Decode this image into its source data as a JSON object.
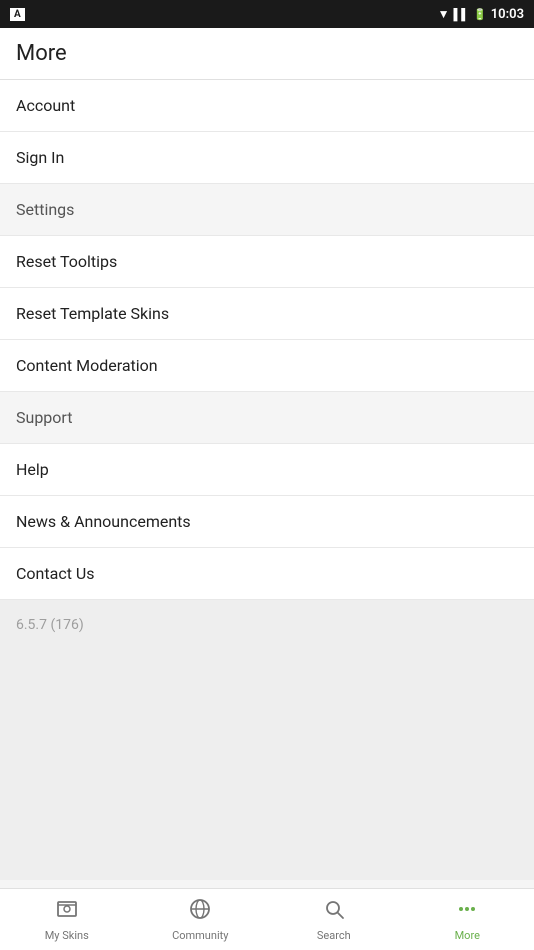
{
  "statusBar": {
    "time": "10:03",
    "appIcon": "A"
  },
  "appBar": {
    "title": "More"
  },
  "menuItems": [
    {
      "id": "account",
      "label": "Account",
      "isSection": false
    },
    {
      "id": "sign-in",
      "label": "Sign In",
      "isSection": false
    },
    {
      "id": "settings",
      "label": "Settings",
      "isSection": true
    },
    {
      "id": "reset-tooltips",
      "label": "Reset Tooltips",
      "isSection": false
    },
    {
      "id": "reset-template-skins",
      "label": "Reset Template Skins",
      "isSection": false
    },
    {
      "id": "content-moderation",
      "label": "Content Moderation",
      "isSection": false
    },
    {
      "id": "support",
      "label": "Support",
      "isSection": true
    },
    {
      "id": "help",
      "label": "Help",
      "isSection": false
    },
    {
      "id": "news-announcements",
      "label": "News & Announcements",
      "isSection": false
    },
    {
      "id": "contact-us",
      "label": "Contact Us",
      "isSection": false
    }
  ],
  "version": {
    "text": "6.5.7 (176)"
  },
  "bottomNav": {
    "items": [
      {
        "id": "my-skins",
        "label": "My Skins",
        "active": false
      },
      {
        "id": "community",
        "label": "Community",
        "active": false
      },
      {
        "id": "search",
        "label": "Search",
        "active": false
      },
      {
        "id": "more",
        "label": "More",
        "active": true
      }
    ]
  }
}
